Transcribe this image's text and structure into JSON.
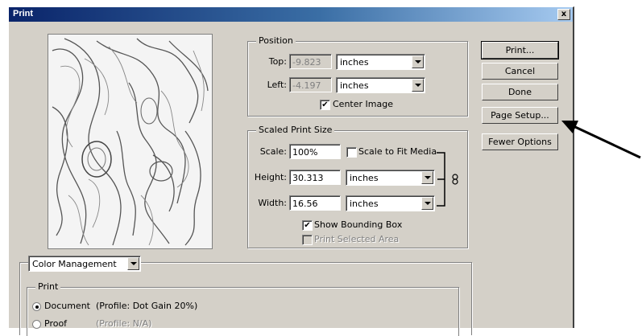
{
  "window": {
    "title": "Print",
    "close_glyph": "x"
  },
  "position": {
    "legend": "Position",
    "top_label": "Top:",
    "top_value": "-9.823",
    "top_unit": "inches",
    "left_label": "Left:",
    "left_value": "-4.197",
    "left_unit": "inches",
    "center_image_label": "Center Image",
    "center_image_checked": true
  },
  "scaled": {
    "legend": "Scaled Print Size",
    "scale_label": "Scale:",
    "scale_value": "100%",
    "fit_label": "Scale to Fit Media",
    "height_label": "Height:",
    "height_value": "30.313",
    "height_unit": "inches",
    "width_label": "Width:",
    "width_value": "16.56",
    "width_unit": "inches",
    "bounding_label": "Show Bounding Box",
    "selected_label": "Print Selected Area"
  },
  "buttons": {
    "print": "Print...",
    "cancel": "Cancel",
    "done": "Done",
    "page_setup": "Page Setup...",
    "fewer": "Fewer Options"
  },
  "color": {
    "dropdown": "Color Management",
    "print_legend": "Print",
    "document_label": "Document",
    "document_profile": "(Profile: Dot Gain 20%)",
    "proof_label": "Proof",
    "proof_profile": "(Profile: N/A)",
    "selected": "Document"
  },
  "icons": {
    "link": "chain-link-icon",
    "arrow": "annotation-arrow"
  }
}
